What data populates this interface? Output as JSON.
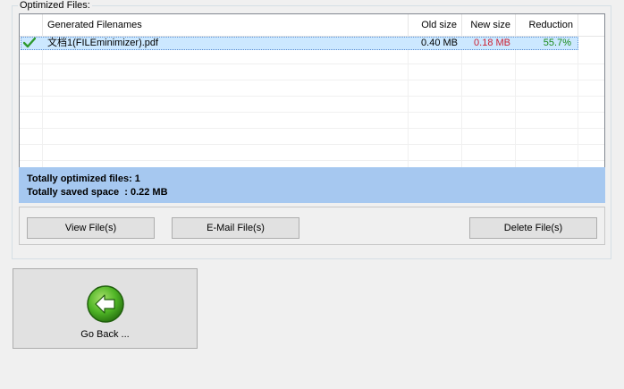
{
  "group": {
    "title": "Optimized Files:"
  },
  "list": {
    "columns": [
      "Generated Filenames",
      "Old size",
      "New size",
      "Reduction"
    ],
    "rows": [
      {
        "filename": "文档1(FILEminimizer).pdf",
        "old_size": "0.40 MB",
        "new_size": "0.18 MB",
        "reduction": "55.7%"
      }
    ]
  },
  "summary": {
    "files_line": "Totally optimized files: 1",
    "saved_line": "Totally saved space  : 0.22 MB"
  },
  "buttons": {
    "view": "View File(s)",
    "email": "E-Mail File(s)",
    "delete": "Delete File(s)",
    "go_back": "Go Back ..."
  },
  "colors": {
    "new_size": "#cc2233",
    "reduction": "#1a8a1a",
    "summary_bg": "#a6c8f0",
    "check": "#2e9a2e"
  }
}
